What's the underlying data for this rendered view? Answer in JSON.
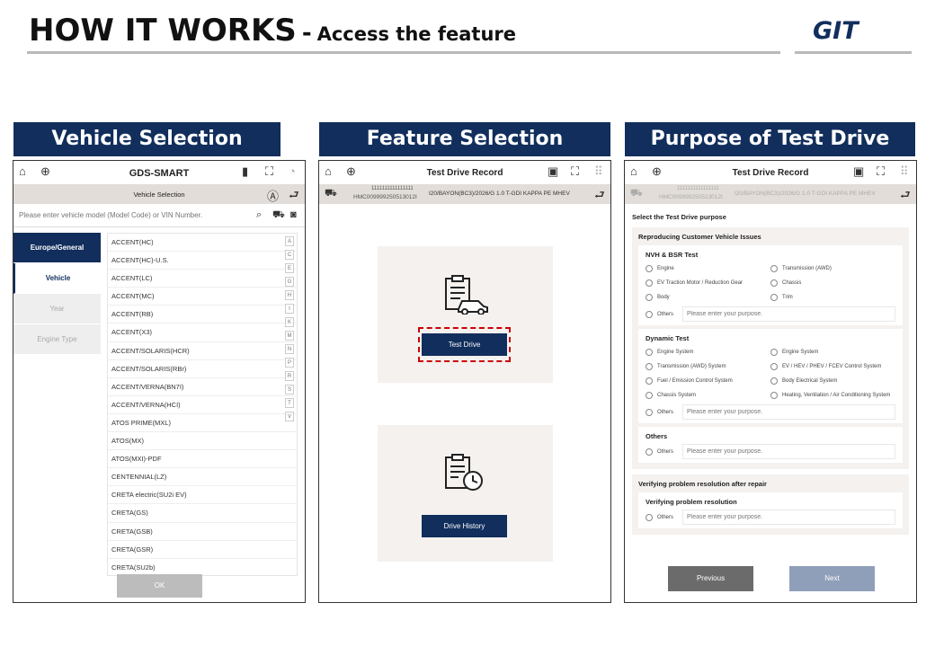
{
  "header": {
    "title": "HOW IT WORKS",
    "dash": "-",
    "subtitle": "Access the feature",
    "logo_text": "GIT"
  },
  "sections": [
    {
      "title": "Vehicle Selection"
    },
    {
      "title": "Feature Selection"
    },
    {
      "title": "Purpose of Test Drive"
    }
  ],
  "panel1": {
    "brand": "GDS-SMART",
    "subtitle": "Vehicle Selection",
    "search_placeholder": "Please enter vehicle model (Model Code) or VIN Number.",
    "side": [
      "Europe/General",
      "Vehicle",
      "Year",
      "Engine Type"
    ],
    "vehicles": [
      "ACCENT(HC)",
      "ACCENT(HC)-U.S.",
      "ACCENT(LC)",
      "ACCENT(MC)",
      "ACCENT(RB)",
      "ACCENT(X3)",
      "ACCENT/SOLARIS(HCR)",
      "ACCENT/SOLARIS(RBr)",
      "ACCENT/VERNA(BN7I)",
      "ACCENT/VERNA(HCI)",
      "ATOS PRIME(MXL)",
      "ATOS(MX)",
      "ATOS(MXI)-PDF",
      "CENTENNIAL(LZ)",
      "CRETA electric(SU2i EV)",
      "CRETA(GS)",
      "CRETA(GSB)",
      "CRETA(GSR)",
      "CRETA(SU2b)"
    ],
    "alphabet": [
      "A",
      "C",
      "E",
      "G",
      "H",
      "I",
      "K",
      "M",
      "N",
      "P",
      "R",
      "S",
      "T",
      "V"
    ],
    "ok": "OK"
  },
  "panel2": {
    "title": "Test Drive Record",
    "vin_top": "1111111111111111",
    "vin": "HMC009999250513012I",
    "vehicle": "I20/BAYON(BC3)/2026/G 1.0 T-GDI KAPPA PE MHEV",
    "test_drive": "Test Drive",
    "drive_history": "Drive History"
  },
  "panel3": {
    "title": "Test Drive Record",
    "vin_top": "1111111111111111",
    "vin": "HMC009999250513012I",
    "vehicle": "I20/BAYON(BC3)/2026/G 1.0 T-GDI KAPPA PE MHEV",
    "prompt": "Select the Test Drive purpose",
    "sec1": "Reproducing Customer Vehicle Issues",
    "nvh": {
      "title": "NVH & BSR Test",
      "options": [
        "Engine",
        "Transmission (AWD)",
        "EV Traction Motor / Reduction Gear",
        "Chassis",
        "Body",
        "Trim"
      ]
    },
    "dynamic": {
      "title": "Dynamic Test",
      "options": [
        "Engine System",
        "Engine System",
        "Transmission (AWD) System",
        "EV / HEV / PHEV / FCEV Control System",
        "Fuel / Emission Control System",
        "Body Electrical System",
        "Chassis System",
        "Heating, Ventilation / Air Conditioning System"
      ]
    },
    "others_title": "Others",
    "others_label": "Others",
    "others_placeholder": "Please enter your purpose.",
    "sec2": "Verifying problem resolution after repair",
    "verify_title": "Verifying problem resolution",
    "previous": "Previous",
    "next": "Next"
  },
  "colors": {
    "navy": "#112e5c",
    "header_bg": "#e2ddd8",
    "card_bg": "#f4f1ef",
    "highlight": "#cc0000"
  }
}
